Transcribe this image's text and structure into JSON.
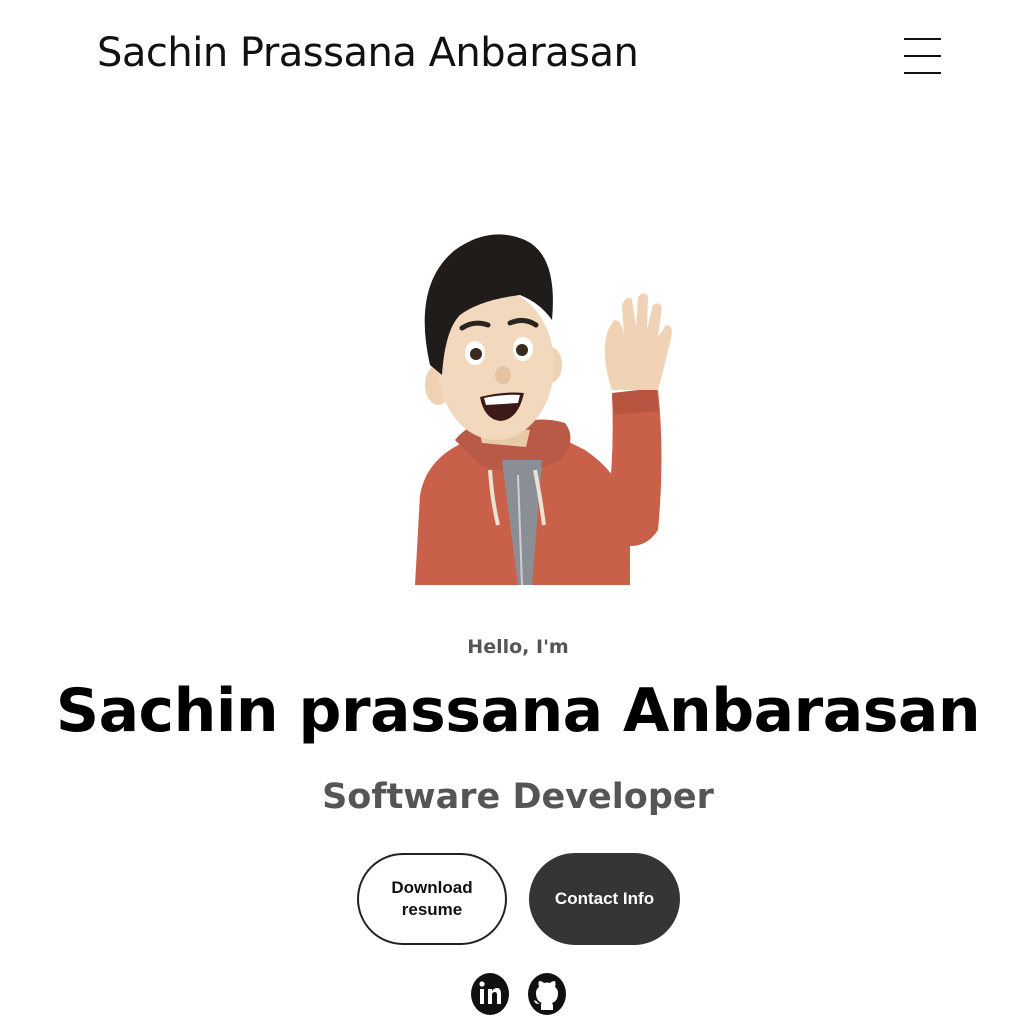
{
  "header": {
    "logo_text": "Sachin Prassana Anbarasan",
    "menu_icon": "hamburger-menu-icon"
  },
  "hero": {
    "avatar_icon": "memoji-avatar-waving",
    "greeting": "Hello, I'm",
    "name": "Sachin prassana Anbarasan",
    "role": "Software Developer"
  },
  "buttons": {
    "download_label": "Download resume",
    "contact_label": "Contact Info"
  },
  "social": {
    "linkedin_icon": "linkedin-icon",
    "github_icon": "github-icon"
  },
  "colors": {
    "text_primary": "#000000",
    "text_secondary": "#555555",
    "button_dark": "#353535",
    "hoodie": "#c9614a"
  }
}
